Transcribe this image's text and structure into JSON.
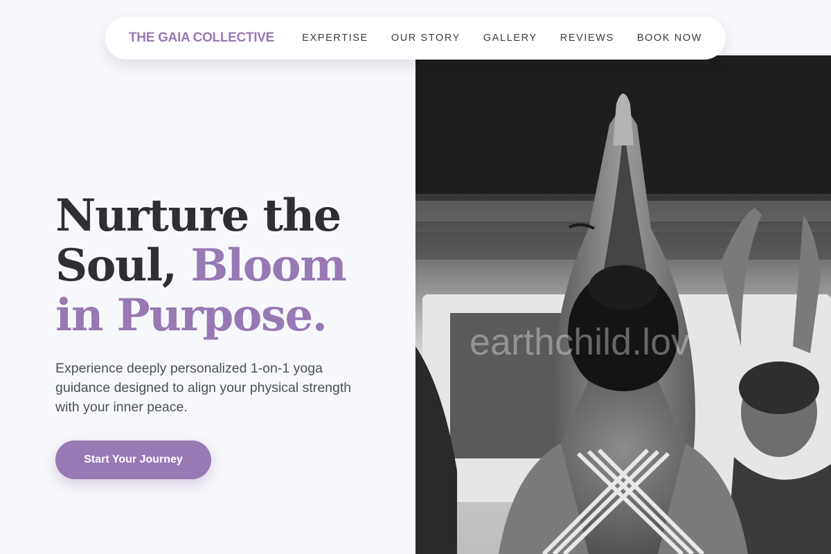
{
  "nav": {
    "brand": "THE GAIA COLLECTIVE",
    "links": [
      {
        "label": "EXPERTISE"
      },
      {
        "label": "OUR STORY"
      },
      {
        "label": "GALLERY"
      },
      {
        "label": "REVIEWS"
      },
      {
        "label": "BOOK NOW"
      }
    ]
  },
  "hero": {
    "headline_line1": "Nurture the",
    "headline_line2_plain": "Soul, ",
    "headline_line2_accent": "Bloom",
    "headline_line3_accent": "in Purpose.",
    "subtext": "Experience deeply personalized 1-on-1 yoga guidance designed to align your physical strength with your inner peace.",
    "cta_label": "Start Your Journey",
    "image": {
      "subject": "black-and-white photo of woman with raised joined hands in yoga class",
      "watermark": "earthchild.lov"
    }
  },
  "colors": {
    "accent": "#9779b4",
    "heading": "#2e2e33",
    "body_text": "#4c4f58",
    "background": "#f7f8fc",
    "nav_bg": "#ffffff"
  }
}
